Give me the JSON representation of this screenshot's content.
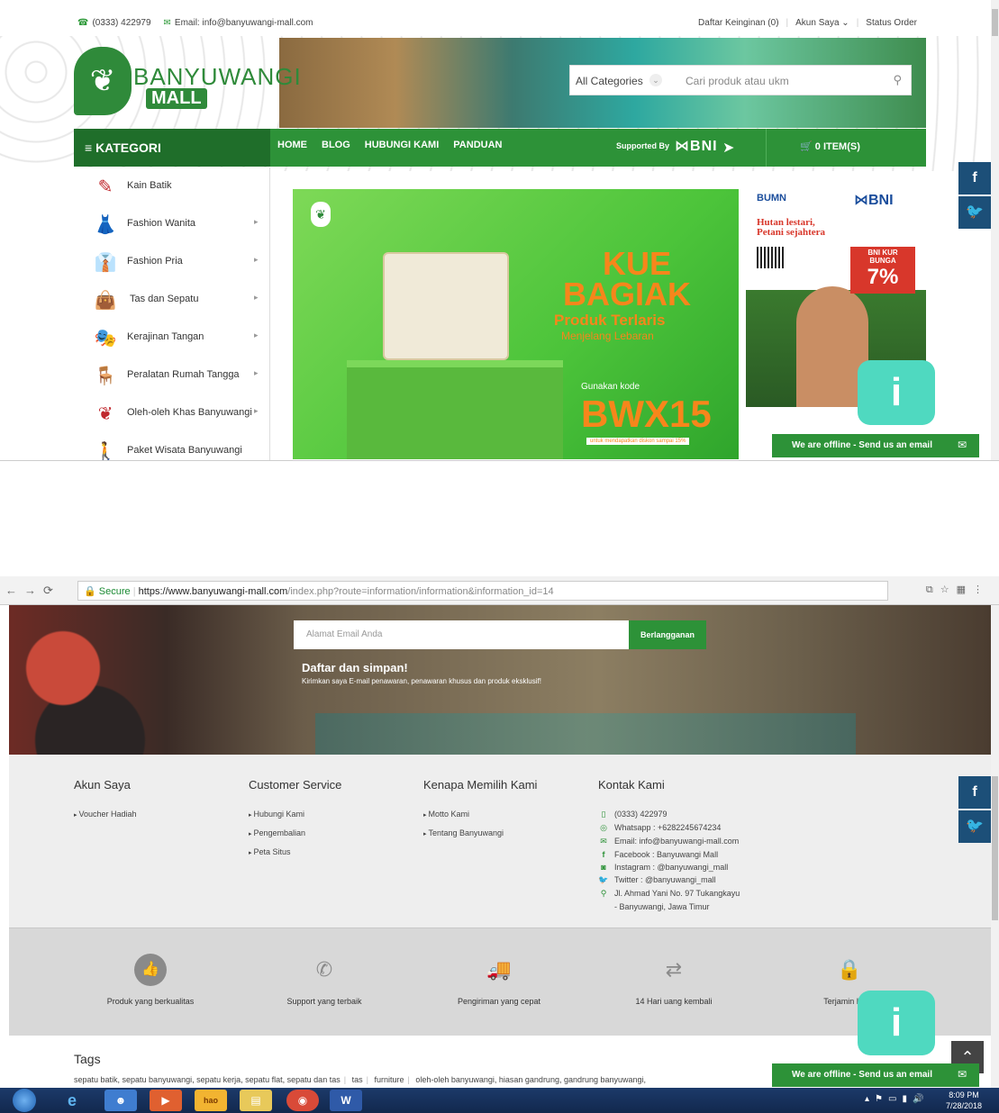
{
  "top": {
    "phone": "(0333) 422979",
    "email": "Email: info@banyuwangi-mall.com",
    "wishlist": "Daftar Keinginan (0)",
    "account": "Akun Saya",
    "order_status": "Status Order",
    "logo_line1": "BANYUWANGI",
    "logo_line2": "MALL",
    "search_category": "All Categories",
    "search_placeholder": "Cari produk atau ukm",
    "kategori": "KATEGORI",
    "menu": [
      "HOME",
      "BLOG",
      "HUBUNGI KAMI",
      "PANDUAN"
    ],
    "supported_by": "Supported By",
    "bni": "BNI",
    "cart": "0 ITEM(S)",
    "categories": [
      "Kain Batik",
      "Fashion Wanita",
      "Fashion Pria",
      "Tas dan Sepatu",
      "Kerajinan Tangan",
      "Peralatan Rumah Tangga",
      "Oleh-oleh Khas Banyuwangi",
      "Paket Wisata Banyuwangi"
    ],
    "hero": {
      "title": "KUE BAGIAK",
      "subtitle": "Produk Terlaris",
      "subtitle2": "Menjelang Lebaran",
      "code_label": "Gunakan kode",
      "code": "BWX15",
      "footnote": "untuk mendapatkan diskon sampai 15%"
    },
    "side_banner": {
      "bumn": "BUMN",
      "bni": "BNI",
      "headline1": "Hutan lestari,",
      "headline2": "Petani sejahtera",
      "kur_label": "BNI KUR",
      "kur_sub": "BUNGA",
      "kur_value": "7%"
    },
    "offline": "We are offline - Send us an email"
  },
  "bottom": {
    "url_secure": "Secure",
    "url_host": "https://www.banyuwangi-mall.com",
    "url_path": "/index.php?route=information/information&information_id=14",
    "email_placeholder": "Alamat Email Anda",
    "subscribe": "Berlangganan",
    "news_title": "Daftar dan simpan!",
    "news_sub": "Kirimkan saya E-mail penawaran, penawaran khusus dan produk eksklusif!",
    "footer": {
      "col1_title": "Akun Saya",
      "col1_links": [
        "Voucher Hadiah"
      ],
      "col2_title": "Customer Service",
      "col2_links": [
        "Hubungi Kami",
        "Pengembalian",
        "Peta Situs"
      ],
      "col3_title": "Kenapa Memilih Kami",
      "col3_links": [
        "Motto Kami",
        "Tentang Banyuwangi"
      ],
      "col4_title": "Kontak Kami",
      "contacts": [
        "(0333) 422979",
        "Whatsapp : +6282245674234",
        "Email: info@banyuwangi-mall.com",
        "Facebook : Banyuwangi Mall",
        "Instagram : @banyuwangi_mall",
        "Twitter : @banyuwangi_mall",
        "Jl. Ahmad Yani No. 97 Tukangkayu",
        "- Banyuwangi, Jawa Timur"
      ]
    },
    "features": [
      "Produk yang berkualitas",
      "Support yang terbaik",
      "Pengiriman yang cepat",
      "14 Hari uang kembali",
      "Terjamin Kean"
    ],
    "tags_title": "Tags",
    "tags": [
      "sepatu batik, sepatu banyuwangi, sepatu kerja, sepatu flat, sepatu dan tas",
      "tas",
      "furniture",
      "oleh-oleh banyuwangi, hiasan gandrung, gandrung banyuwangi,"
    ],
    "offline": "We are offline - Send us an email"
  },
  "taskbar": {
    "hao": "hao",
    "time": "8:09 PM",
    "date": "7/28/2018"
  },
  "colors": {
    "brand_green": "#2d9238",
    "dark_green": "#1f6e2a",
    "facebook_blue": "#1c4f78",
    "accent_orange": "#f7861b"
  }
}
